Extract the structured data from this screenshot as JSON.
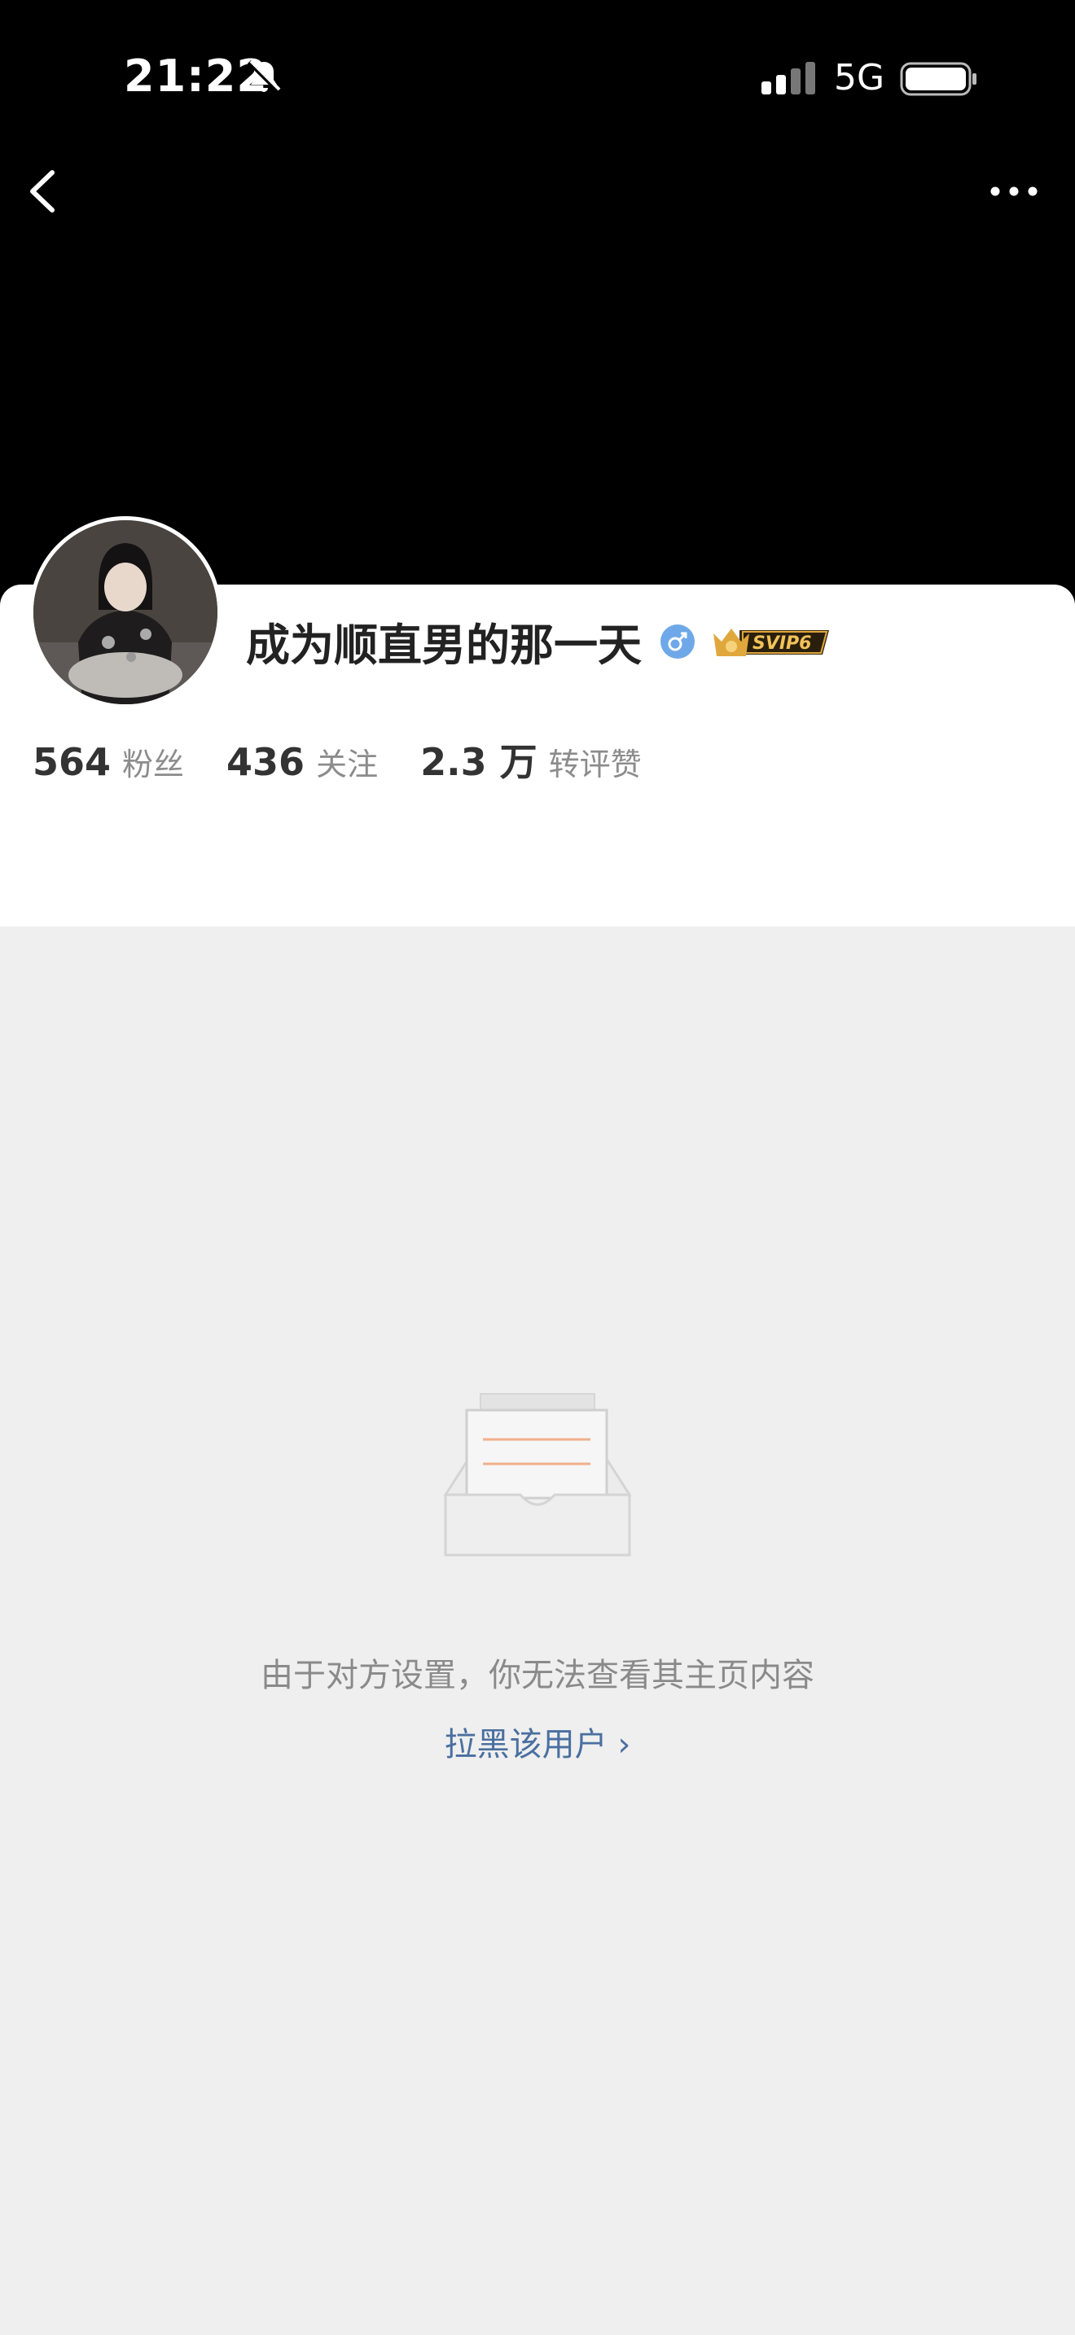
{
  "status_bar": {
    "time": "21:22",
    "network": "5G",
    "icons": [
      "bell-off-icon",
      "signal-icon",
      "battery-icon"
    ]
  },
  "nav": {
    "back_icon": "chevron-left-icon",
    "more_icon": "more-horizontal-icon"
  },
  "profile": {
    "name": "成为顺直男的那一天",
    "gender_icon": "male-icon",
    "badge": "SVIP6",
    "stats": [
      {
        "value": "564",
        "label": "粉丝"
      },
      {
        "value": "436",
        "label": "关注"
      },
      {
        "value": "2.3 万",
        "label": "转评赞"
      }
    ]
  },
  "empty_state": {
    "icon": "empty-inbox-icon",
    "message": "由于对方设置，你无法查看其主页内容",
    "link": "拉黑该用户 ›"
  },
  "colors": {
    "header_bg": "#000000",
    "page_bg": "#efefef",
    "link": "#4a6fa0",
    "gender": "#6ea8e8",
    "badge_gold": "#e0a83c"
  }
}
